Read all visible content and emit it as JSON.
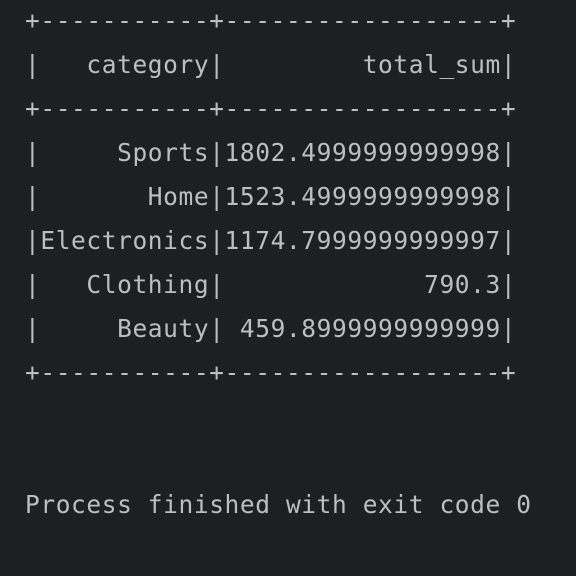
{
  "console": {
    "table_lines": [
      "+-----------+------------------+",
      "|   category|         total_sum|",
      "+-----------+------------------+",
      "|     Sports|1802.4999999999998|",
      "|       Home|1523.4999999999998|",
      "|Electronics|1174.7999999999997|",
      "|   Clothing|             790.3|",
      "|     Beauty| 459.8999999999999|",
      "+-----------+------------------+"
    ],
    "exit_message": "Process finished with exit code 0"
  }
}
